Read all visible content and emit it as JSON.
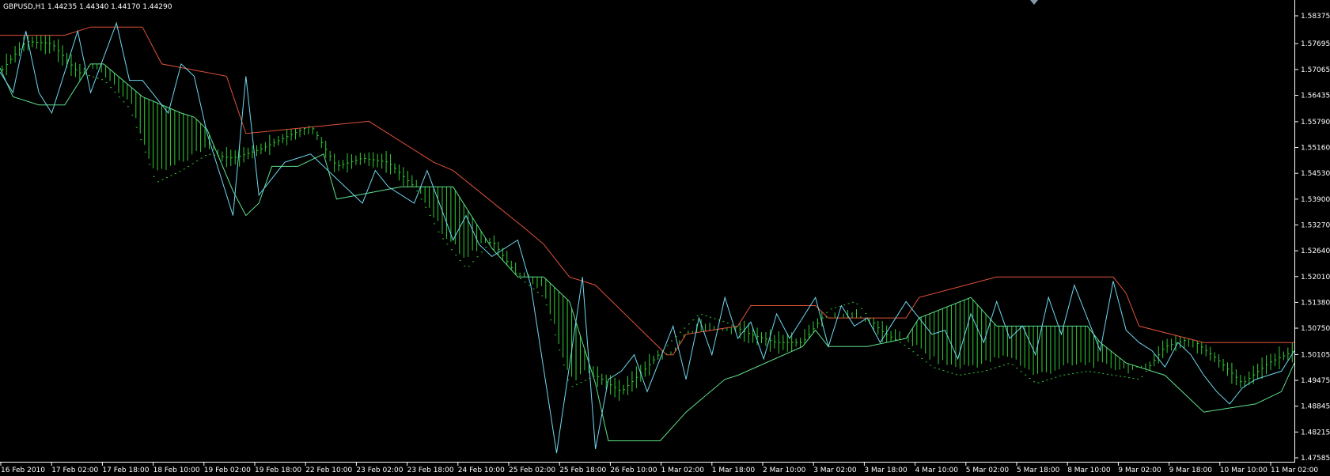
{
  "window": {
    "symbol": "GBPUSD,H1",
    "ohlc": "1.44235 1.44340 1.44170 1.44290",
    "title": "GBPUSD,H1  1.44235 1.44340 1.44170 1.44290"
  },
  "colors": {
    "background": "#000000",
    "price_bars": "#32cd32",
    "upper_band": "#e0533a",
    "lower_band": "#5fe08c",
    "zigzag": "#6fd8f0",
    "axis_text": "#ffffff"
  },
  "chart_data": {
    "type": "line",
    "title": "GBPUSD,H1  1.44235 1.44340 1.44170 1.44290",
    "xlabel": "",
    "ylabel": "",
    "grid": false,
    "y_ticks": [
      "1.58375",
      "1.57695",
      "1.57065",
      "1.56435",
      "1.55790",
      "1.55160",
      "1.54530",
      "1.53900",
      "1.53270",
      "1.52640",
      "1.52010",
      "1.51380",
      "1.50750",
      "1.50105",
      "1.49475",
      "1.48845",
      "1.48215",
      "1.47585"
    ],
    "y_tick_values": [
      1.58375,
      1.57695,
      1.57065,
      1.56435,
      1.5579,
      1.5516,
      1.5453,
      1.539,
      1.5327,
      1.5264,
      1.5201,
      1.5138,
      1.5075,
      1.50105,
      1.49475,
      1.48845,
      1.48215,
      1.47585
    ],
    "ylim": [
      1.47585,
      1.58375
    ],
    "x_ticks": [
      "16 Feb 2010",
      "17 Feb 02:00",
      "17 Feb 18:00",
      "18 Feb 10:00",
      "19 Feb 02:00",
      "19 Feb 18:00",
      "22 Feb 10:00",
      "23 Feb 02:00",
      "23 Feb 18:00",
      "24 Feb 10:00",
      "25 Feb 02:00",
      "25 Feb 18:00",
      "26 Feb 10:00",
      "1 Mar 02:00",
      "1 Mar 18:00",
      "2 Mar 10:00",
      "3 Mar 02:00",
      "3 Mar 18:00",
      "4 Mar 10:00",
      "5 Mar 02:00",
      "5 Mar 18:00",
      "8 Mar 10:00",
      "9 Mar 02:00",
      "9 Mar 18:00",
      "10 Mar 10:00",
      "11 Mar 02:00"
    ],
    "xlim": [
      0,
      100
    ],
    "series": [
      {
        "role": "close",
        "x": [
          0,
          2,
          4,
          6,
          8,
          10,
          12,
          14,
          16,
          18,
          20,
          22,
          24,
          26,
          28,
          30,
          32,
          34,
          36,
          38,
          40,
          42,
          44,
          46,
          48,
          50,
          52,
          54,
          56,
          58,
          60,
          62,
          64,
          66,
          68,
          70,
          72,
          74,
          76,
          78,
          80,
          82,
          84,
          86,
          88,
          90,
          92,
          94,
          96,
          98,
          100
        ],
        "values": [
          1.57,
          1.5775,
          1.577,
          1.57,
          1.568,
          1.561,
          1.543,
          1.546,
          1.55,
          1.549,
          1.551,
          1.554,
          1.557,
          1.547,
          1.549,
          1.548,
          1.542,
          1.53,
          1.522,
          1.529,
          1.52,
          1.515,
          1.493,
          1.496,
          1.492,
          1.498,
          1.505,
          1.511,
          1.509,
          1.506,
          1.504,
          1.504,
          1.512,
          1.514,
          1.507,
          1.503,
          1.498,
          1.496,
          1.497,
          1.499,
          1.494,
          1.496,
          1.497,
          1.496,
          1.495,
          1.503,
          1.505,
          1.5,
          1.494,
          1.499,
          1.502
        ]
      },
      {
        "role": "upper",
        "x": [
          0,
          5,
          7,
          11,
          12.5,
          17.5,
          19,
          28.5,
          33.5,
          35,
          40.5,
          42,
          44,
          46,
          51.5,
          52,
          53,
          57,
          58,
          63,
          64,
          70,
          71,
          77,
          81,
          86,
          87,
          88,
          93,
          95,
          100
        ],
        "values": [
          1.579,
          1.579,
          1.581,
          1.581,
          1.572,
          1.569,
          1.555,
          1.558,
          1.548,
          1.546,
          1.532,
          1.528,
          1.52,
          1.518,
          1.501,
          1.501,
          1.506,
          1.508,
          1.513,
          1.513,
          1.51,
          1.51,
          1.515,
          1.52,
          1.52,
          1.52,
          1.516,
          1.508,
          1.504,
          1.504,
          1.504
        ]
      },
      {
        "role": "lower",
        "x": [
          0,
          1,
          3,
          5,
          7,
          8,
          11,
          14,
          15,
          16,
          18,
          19,
          20,
          21,
          23,
          25,
          26,
          31,
          35,
          38,
          40,
          42,
          44,
          46,
          47,
          48,
          51,
          53,
          56,
          57,
          62,
          63,
          64,
          65,
          67,
          70,
          71,
          75,
          77,
          80,
          83,
          84,
          85,
          87,
          90,
          93,
          97,
          99,
          100
        ],
        "values": [
          1.571,
          1.564,
          1.562,
          1.562,
          1.572,
          1.572,
          1.564,
          1.56,
          1.559,
          1.556,
          1.541,
          1.535,
          1.538,
          1.547,
          1.547,
          1.55,
          1.539,
          1.542,
          1.542,
          1.527,
          1.52,
          1.52,
          1.514,
          1.494,
          1.48,
          1.48,
          1.48,
          1.487,
          1.495,
          1.496,
          1.503,
          1.507,
          1.503,
          1.503,
          1.503,
          1.505,
          1.51,
          1.515,
          1.508,
          1.508,
          1.508,
          1.508,
          1.504,
          1.499,
          1.496,
          1.487,
          1.489,
          1.492,
          1.499
        ]
      },
      {
        "role": "zigzag",
        "x": [
          0,
          1,
          2,
          3,
          4,
          6,
          7,
          9,
          10,
          11,
          13,
          14,
          15,
          16,
          18,
          19,
          20,
          22,
          24,
          28,
          29,
          30,
          32,
          33,
          35,
          36,
          37,
          38,
          40,
          41,
          43,
          45,
          46,
          47,
          48,
          49,
          50,
          52,
          53,
          54,
          55,
          56,
          57,
          58,
          59,
          60,
          61,
          63,
          64,
          65,
          66,
          67,
          68,
          70,
          72,
          73,
          74,
          75,
          76,
          77,
          78,
          79,
          80,
          81,
          82,
          83,
          84,
          85,
          86,
          87,
          88,
          89,
          90,
          91,
          92,
          93,
          94,
          95,
          96,
          97,
          99,
          100
        ],
        "values": [
          1.57,
          1.565,
          1.58,
          1.565,
          1.56,
          1.58,
          1.565,
          1.582,
          1.568,
          1.568,
          1.56,
          1.572,
          1.569,
          1.555,
          1.535,
          1.569,
          1.54,
          1.548,
          1.55,
          1.538,
          1.546,
          1.542,
          1.538,
          1.546,
          1.529,
          1.535,
          1.528,
          1.525,
          1.529,
          1.518,
          1.477,
          1.52,
          1.478,
          1.495,
          1.497,
          1.501,
          1.492,
          1.508,
          1.495,
          1.51,
          1.501,
          1.515,
          1.505,
          1.509,
          1.5,
          1.511,
          1.505,
          1.515,
          1.503,
          1.513,
          1.508,
          1.51,
          1.504,
          1.514,
          1.506,
          1.507,
          1.5,
          1.511,
          1.504,
          1.514,
          1.505,
          1.508,
          1.501,
          1.515,
          1.506,
          1.518,
          1.51,
          1.502,
          1.519,
          1.507,
          1.504,
          1.502,
          1.498,
          1.504,
          1.501,
          1.496,
          1.492,
          1.489,
          1.493,
          1.495,
          1.497,
          1.502
        ]
      }
    ]
  }
}
